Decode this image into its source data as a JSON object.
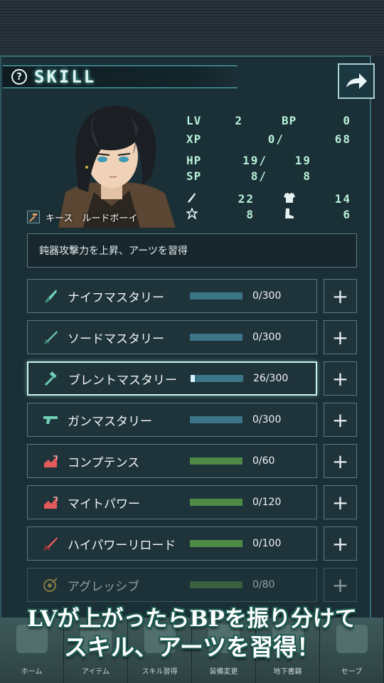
{
  "header": {
    "help_label": "?",
    "title": "SKILL"
  },
  "character": {
    "name": "キース　ルードボーイ"
  },
  "stats": {
    "lv_label": "LV",
    "lv_value": "2",
    "bp_label": "BP",
    "bp_value": "0",
    "xp_label": "XP",
    "xp_value": "0/",
    "xp_max": "68",
    "hp_label": "HP",
    "hp_value": "19/",
    "hp_max": "19",
    "sp_label": "SP",
    "sp_value": "8/",
    "sp_max": "8",
    "atk_value": "22",
    "def_value": "14",
    "mag_value": "8",
    "spd_value": "6"
  },
  "description": "鈍器攻撃力を上昇、アーツを習得",
  "skills": [
    {
      "name": "ナイフマスタリー",
      "count": "0/300",
      "progress": 0,
      "bar": "blue",
      "icon": "knife-icon"
    },
    {
      "name": "ソードマスタリー",
      "count": "0/300",
      "progress": 0,
      "bar": "blue",
      "icon": "sword-icon"
    },
    {
      "name": "ブレントマスタリー",
      "count": "26/300",
      "progress": 0.0867,
      "bar": "blue",
      "icon": "hammer-icon"
    },
    {
      "name": "ガンマスタリー",
      "count": "0/300",
      "progress": 0,
      "bar": "blue",
      "icon": "gun-icon"
    },
    {
      "name": "コンプテンス",
      "count": "0/60",
      "progress": 0,
      "bar": "green",
      "icon": "chart-up-icon"
    },
    {
      "name": "マイトパワー",
      "count": "0/120",
      "progress": 0,
      "bar": "green",
      "icon": "chart-up-icon"
    },
    {
      "name": "ハイパワーリロード",
      "count": "0/100",
      "progress": 0,
      "bar": "green",
      "icon": "red-sword-icon"
    },
    {
      "name": "アグレッシブ",
      "count": "0/80",
      "progress": 0,
      "bar": "green",
      "icon": "target-icon"
    }
  ],
  "plus_label": "+",
  "nav": [
    {
      "label": "ホーム"
    },
    {
      "label": "アイテム"
    },
    {
      "label": "スキル習得"
    },
    {
      "label": "装備変更"
    },
    {
      "label": "地下書籍"
    },
    {
      "label": "セーブ"
    }
  ],
  "promo": {
    "line1": "LVが上がったらBPを振り分けて",
    "line2": "スキル、アーツを習得！"
  },
  "colors": {
    "accent": "#55c2c8",
    "bar_blue": "#3c7488",
    "bar_green": "#4e8a46"
  }
}
